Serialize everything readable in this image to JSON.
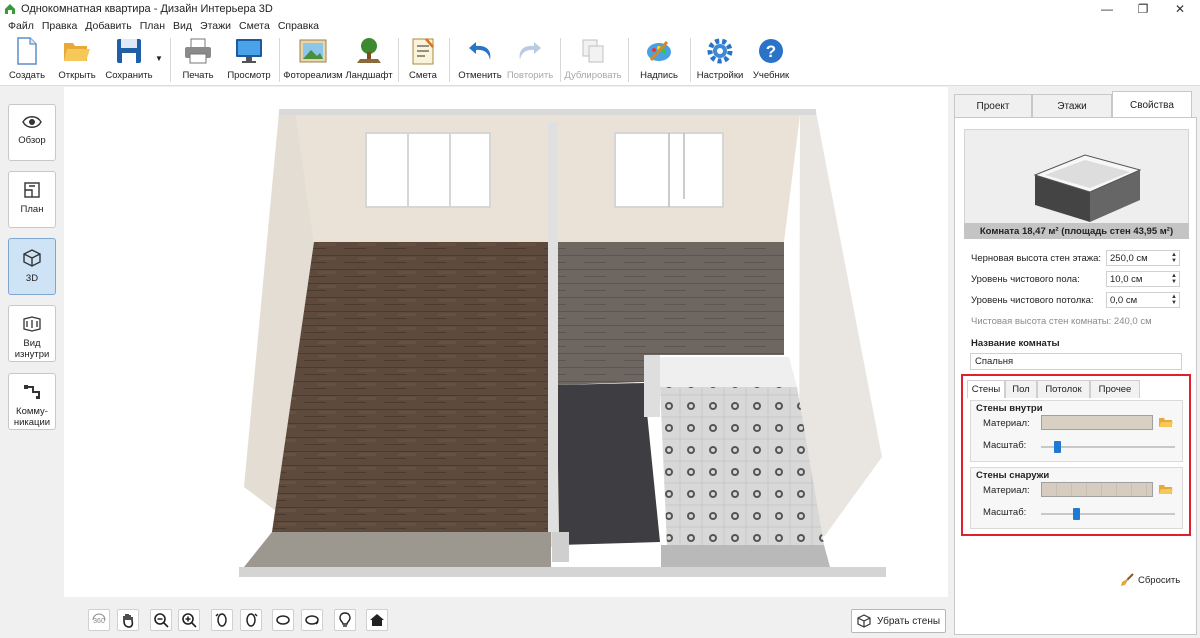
{
  "window": {
    "title": "Однокомнатная квартира - Дизайн Интерьера 3D",
    "controls": [
      "—",
      "❐",
      "✕"
    ]
  },
  "menu": [
    "Файл",
    "Правка",
    "Добавить",
    "План",
    "Вид",
    "Этажи",
    "Смета",
    "Справка"
  ],
  "toolbar": {
    "create": "Создать",
    "open": "Открыть",
    "save": "Сохранить",
    "print": "Печать",
    "preview": "Просмотр",
    "photoreal": "Фотореализм",
    "landscape": "Ландшафт",
    "estimate": "Смета",
    "undo": "Отменить",
    "redo": "Повторить",
    "duplicate": "Дублировать",
    "caption": "Надпись",
    "settings": "Настройки",
    "tutorial": "Учебник"
  },
  "sidebar": {
    "overview": "Обзор",
    "plan": "План",
    "view3d": "3D",
    "inside": "Вид изнутри",
    "utilities": "Комму-никации"
  },
  "viewport": {
    "remove_walls": "Убрать стены"
  },
  "panel": {
    "tabs": [
      "Проект",
      "Этажи",
      "Свойства"
    ],
    "preview_caption": "Комната 18,47 м²  (площадь стен 43,95 м²)",
    "props": {
      "rough_height_label": "Черновая высота стен этажа:",
      "rough_height_value": "250,0 см",
      "floor_level_label": "Уровень чистового пола:",
      "floor_level_value": "10,0 см",
      "ceiling_level_label": "Уровень чистового потолка:",
      "ceiling_level_value": "0,0 см",
      "clean_height": "Чистовая высота стен комнаты: 240,0 см"
    },
    "room_name_label": "Название комнаты",
    "room_name_value": "Спальня",
    "subtabs": [
      "Стены",
      "Пол",
      "Потолок",
      "Прочее"
    ],
    "inner": {
      "title": "Стены внутри",
      "material_label": "Материал:",
      "scale_label": "Масштаб:",
      "scale_fraction": 0.12
    },
    "outer": {
      "title": "Стены снаружи",
      "material_label": "Материал:",
      "scale_label": "Масштаб:",
      "scale_fraction": 0.26
    },
    "reset": "Сбросить"
  },
  "colors": {
    "accent": "#1e7bd4",
    "highlight_border": "#e0202a",
    "active_sidebar": "#cfe3f6"
  }
}
